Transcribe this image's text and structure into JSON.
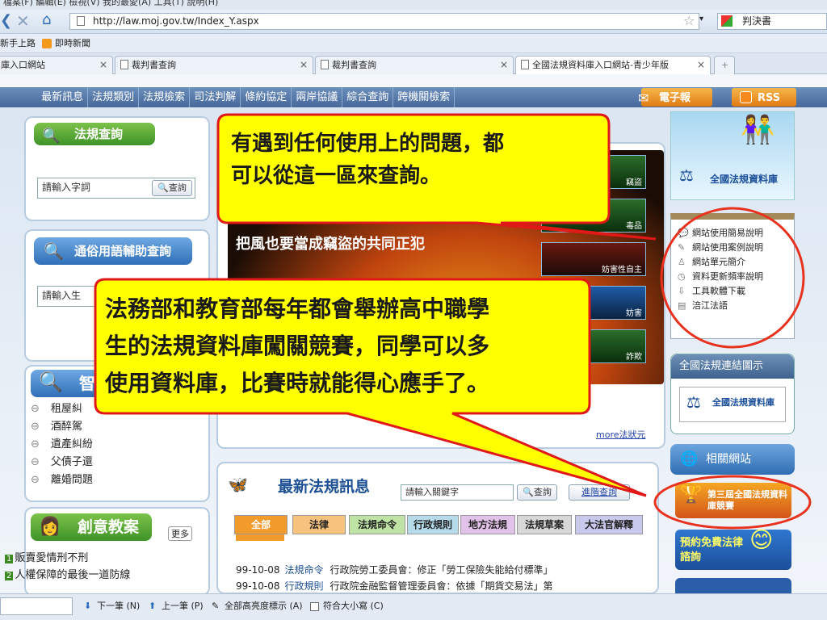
{
  "browser": {
    "menu": "檔案(F)  編輯(E)  檢視(V)  我的最愛(A)  工具(T)  說明(H)",
    "url": "http://law.moj.gov.tw/Index_Y.aspx",
    "search_label": "判決書",
    "favorites": [
      "新手上路",
      "即時新聞"
    ],
    "tabs": [
      {
        "label": "庫入口網站"
      },
      {
        "label": "裁判書查詢"
      },
      {
        "label": "裁判書查詢"
      },
      {
        "label": "全國法規資料庫入口網站-青少年版"
      }
    ]
  },
  "nav": {
    "items": [
      "最新訊息",
      "法規類別",
      "法規檢索",
      "司法判解",
      "條約協定",
      "兩岸協議",
      "綜合查詢",
      "跨機關檢索"
    ],
    "epaper": "電子報",
    "rss": "RSS"
  },
  "law_query": {
    "title": "法規查詢",
    "placeholder": "請輸入字詞",
    "button": "查詢"
  },
  "common_terms": {
    "title": "通俗用語輔助查詢",
    "placeholder": "請輸入生"
  },
  "smart": {
    "title": "智",
    "items": [
      "租屋糾",
      "酒醉駕",
      "遺產糾紛",
      "父債子還",
      "離婚問題"
    ]
  },
  "creative": {
    "title": "創意教案",
    "more": "更多",
    "items": [
      "販賣愛情刑不刑",
      "人權保障的最後一道防線"
    ]
  },
  "banner": {
    "slogan": "把風也要當成竊盜的共同正犯",
    "thumb_labels": [
      "竊盜",
      "毒品",
      "妨害性自主",
      "妨害",
      "詐欺"
    ],
    "more_link": "more法狀元"
  },
  "news": {
    "title": "最新法規訊息",
    "placeholder": "請輸入關鍵字",
    "button": "查詢",
    "advanced": "進階查詢",
    "categories": [
      "全部",
      "法律",
      "法規命令",
      "行政規則",
      "地方法規",
      "法規草案",
      "大法官解釋"
    ],
    "items": [
      {
        "date": "99-10-08",
        "type": "法規命令",
        "text": "行政院勞工委員會：修正「勞工保險失能給付標準」"
      },
      {
        "date": "99-10-08",
        "type": "行政規則",
        "text": "行政院金融監督管理委員會：依據「期貨交易法」第"
      }
    ]
  },
  "right": {
    "logo": "全國法規資料庫",
    "help_items": [
      "網站使用簡易說明",
      "網站使用案例說明",
      "網站單元簡介",
      "資料更新頻率說明",
      "工具軟體下載",
      "涪江法語"
    ],
    "link_map": "全國法規連結圖示",
    "logo2": "全國法規資料庫",
    "related": "相關網站",
    "contest": "第三屆全國法規資料庫競賽",
    "free_consult": "預約免費法律諮詢"
  },
  "callouts": {
    "top": [
      "有遇到任何使用上的問題，都",
      "可以從這一區來查詢。"
    ],
    "main": [
      "法務部和教育部每年都會舉辦高中職學",
      "生的法規資料庫闖關競賽，同學可以多",
      "使用資料庫，比賽時就能得心應手了。"
    ]
  },
  "findbar": {
    "next": "下一筆 (N)",
    "prev": "上一筆 (P)",
    "highlight": "全部高亮度標示 (A)",
    "match_case": "符合大小寫 (C)"
  }
}
